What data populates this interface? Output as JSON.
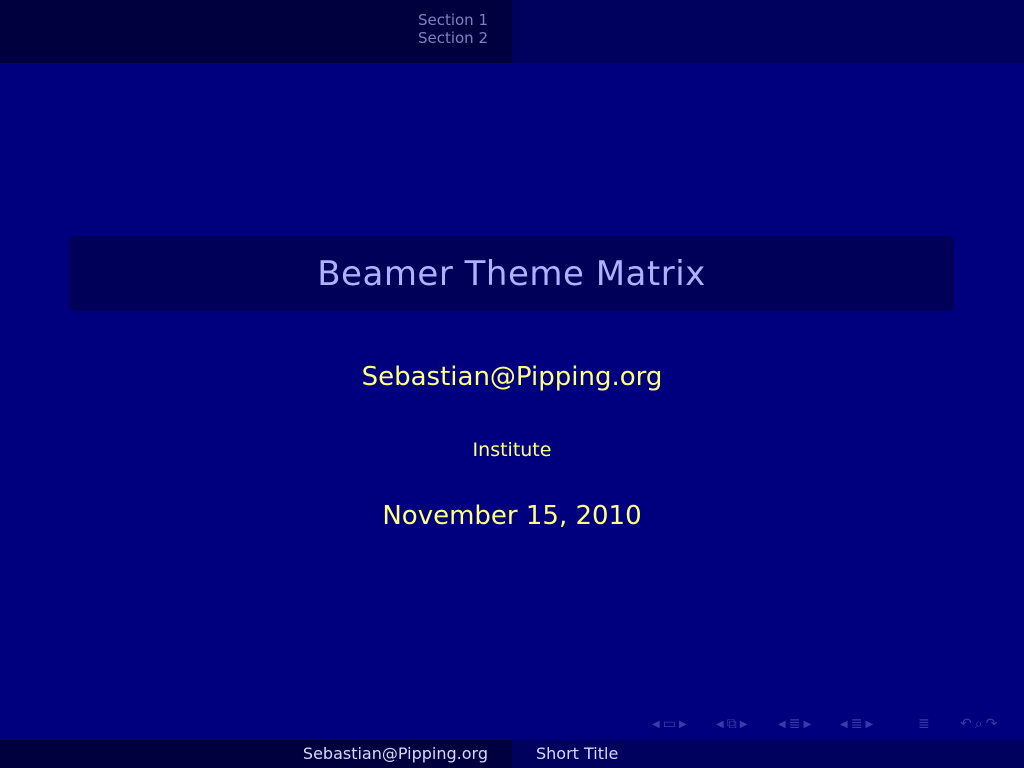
{
  "header": {
    "sections": [
      "Section 1",
      "Section 2"
    ]
  },
  "title_page": {
    "title": "Beamer Theme Matrix",
    "author": "Sebastian@Pipping.org",
    "institute": "Institute",
    "date": "November 15, 2010"
  },
  "nav_symbols": [
    "slide-nav",
    "frame-nav",
    "subsection-nav",
    "section-nav",
    "document-nav",
    "search-icon"
  ],
  "footer": {
    "author": "Sebastian@Pipping.org",
    "short_title": "Short Title"
  },
  "colors": {
    "background": "#00007f",
    "title_text": "#b0b0ff",
    "author_text": "#ffff80",
    "header_dark": "#00003f",
    "header_mid": "#00005e"
  }
}
